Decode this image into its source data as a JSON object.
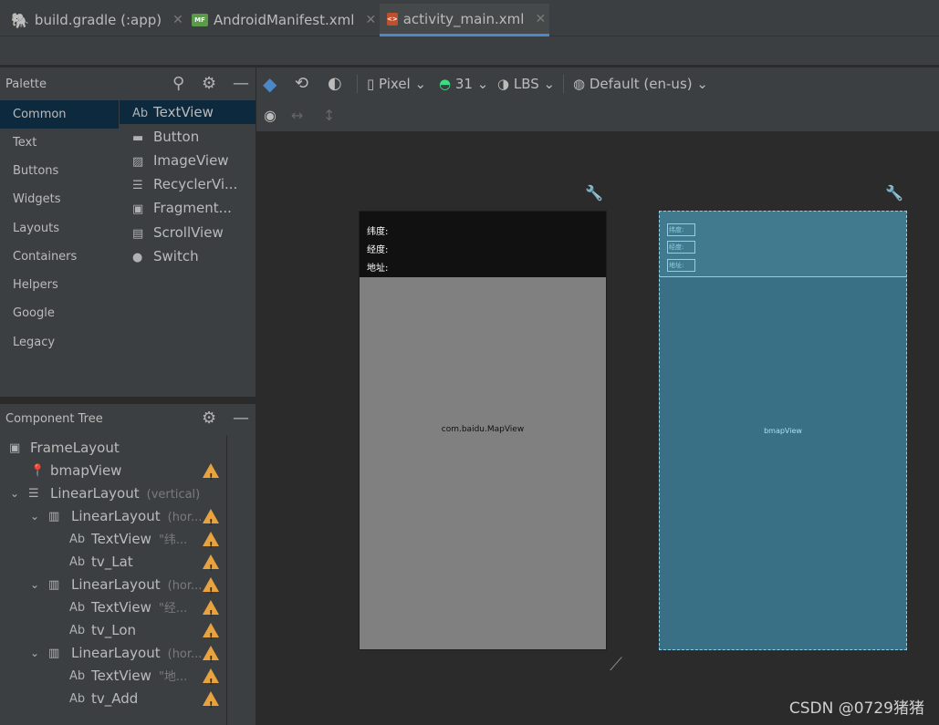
{
  "tabs": [
    {
      "label": "build.gradle (:app)",
      "icon": "gradle-icon"
    },
    {
      "label": "AndroidManifest.xml",
      "icon": "manifest-icon",
      "badge": "MF"
    },
    {
      "label": "activity_main.xml",
      "icon": "layout-xml-icon",
      "active": true
    }
  ],
  "palette": {
    "title": "Palette",
    "categories": [
      "Common",
      "Text",
      "Buttons",
      "Widgets",
      "Layouts",
      "Containers",
      "Helpers",
      "Google",
      "Legacy"
    ],
    "items": [
      {
        "label": "TextView",
        "icon": "Ab"
      },
      {
        "label": "Button",
        "icon": "▬"
      },
      {
        "label": "ImageView",
        "icon": "▨"
      },
      {
        "label": "RecyclerVi...",
        "icon": "☰"
      },
      {
        "label": "Fragment...",
        "icon": "▣"
      },
      {
        "label": "ScrollView",
        "icon": "▤"
      },
      {
        "label": "Switch",
        "icon": "●"
      }
    ]
  },
  "tree": {
    "title": "Component Tree",
    "rows": [
      {
        "label": "FrameLayout",
        "hint": ""
      },
      {
        "label": "bmapView",
        "hint": ""
      },
      {
        "label": "LinearLayout",
        "hint": "(vertical)"
      },
      {
        "label": "LinearLayout",
        "hint": "(hor..."
      },
      {
        "label": "TextView",
        "hint": "\"纬..."
      },
      {
        "label": "tv_Lat",
        "hint": ""
      },
      {
        "label": "LinearLayout",
        "hint": "(hor..."
      },
      {
        "label": "TextView",
        "hint": "\"经..."
      },
      {
        "label": "tv_Lon",
        "hint": ""
      },
      {
        "label": "LinearLayout",
        "hint": "(hor..."
      },
      {
        "label": "TextView",
        "hint": "\"地..."
      },
      {
        "label": "tv_Add",
        "hint": ""
      }
    ]
  },
  "toolbar": {
    "device": "Pixel",
    "api": "31",
    "theme": "LBS",
    "locale": "Default (en-us)"
  },
  "preview": {
    "lines": [
      "纬度:",
      "经度:",
      "地址:"
    ],
    "map_label": "com.baidu.MapView",
    "blueprint_boxes": [
      "纬度:",
      "经度:",
      "地址:"
    ],
    "blueprint_label": "bmapView"
  },
  "watermark": "CSDN @0729猪猪",
  "colors": {
    "selection": "#0d293e",
    "warning": "#e8a33e",
    "blueprint": "#3a7085"
  }
}
